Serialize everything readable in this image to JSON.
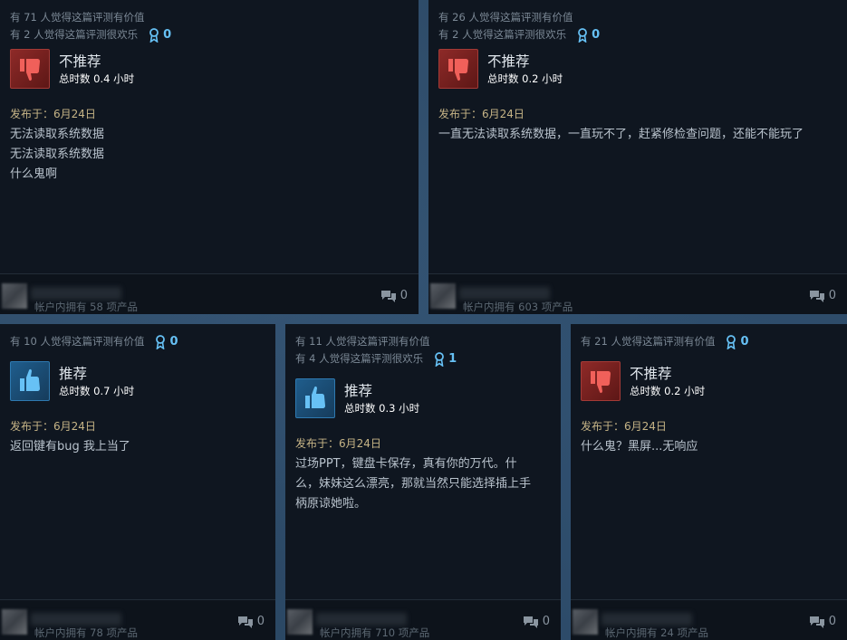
{
  "reviews": [
    {
      "helpful": "有 71 人觉得这篇评测有价值",
      "funny": "有 2 人觉得这篇评测很欢乐",
      "awards": "0",
      "recommended": false,
      "vote_title": "不推荐",
      "hours": "总时数 0.4 小时",
      "posted": "发布于：6月24日",
      "lines": [
        "无法读取系统数据",
        "无法读取系统数据",
        "什么鬼啊"
      ],
      "owned": "帐户内拥有 58 项产品",
      "comments": "0"
    },
    {
      "helpful": "有 26 人觉得这篇评测有价值",
      "funny": "有 2 人觉得这篇评测很欢乐",
      "awards": "0",
      "recommended": false,
      "vote_title": "不推荐",
      "hours": "总时数 0.2 小时",
      "posted": "发布于：6月24日",
      "lines": [
        "一直无法读取系统数据，一直玩不了，赶紧修检查问题，还能不能玩了"
      ],
      "owned": "帐户内拥有 603 项产品",
      "comments": "0"
    },
    {
      "helpful": "有 10 人觉得这篇评测有价值",
      "funny": "",
      "awards": "0",
      "recommended": true,
      "vote_title": "推荐",
      "hours": "总时数 0.7 小时",
      "posted": "发布于：6月24日",
      "lines": [
        "返回键有bug 我上当了"
      ],
      "owned": "帐户内拥有 78 项产品",
      "comments": "0"
    },
    {
      "helpful": "有 11 人觉得这篇评测有价值",
      "funny": "有 4 人觉得这篇评测很欢乐",
      "awards": "1",
      "recommended": true,
      "vote_title": "推荐",
      "hours": "总时数 0.3 小时",
      "posted": "发布于：6月24日",
      "lines": [
        "过场PPT，键盘卡保存，真有你的万代。什",
        "么，妹妹这么漂亮，那就当然只能选择插上手",
        "柄原谅她啦。"
      ],
      "owned": "帐户内拥有 710 项产品",
      "comments": "0"
    },
    {
      "helpful": "有 21 人觉得这篇评测有价值",
      "funny": "",
      "awards": "0",
      "recommended": false,
      "vote_title": "不推荐",
      "hours": "总时数 0.2 小时",
      "posted": "发布于：6月24日",
      "lines": [
        "什么鬼？黑屏...无响应"
      ],
      "owned": "帐户内拥有 24 项产品",
      "comments": "0"
    }
  ]
}
